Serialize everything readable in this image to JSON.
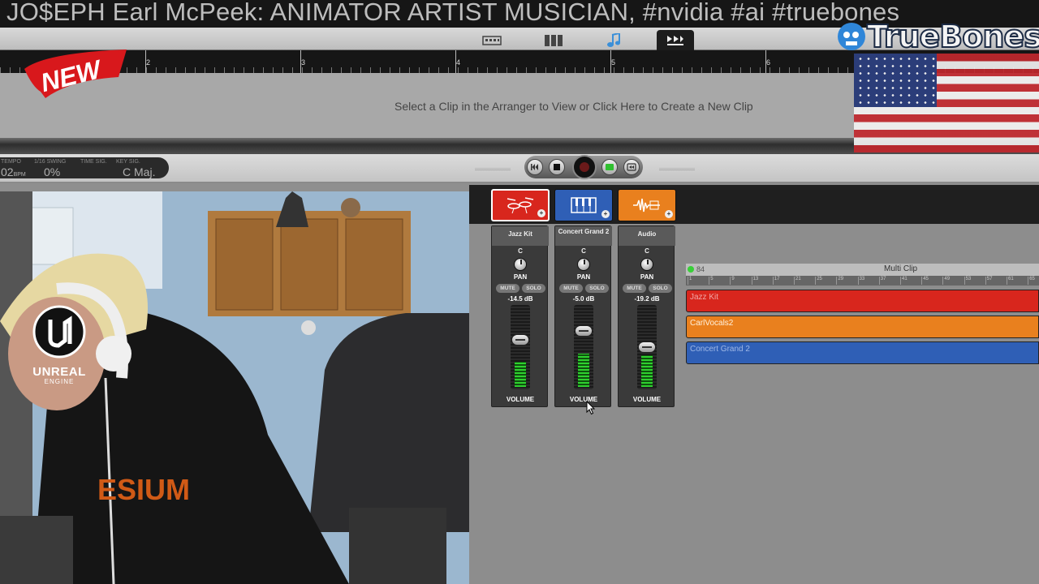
{
  "banner": {
    "title": "JO$EPH Earl McPeek: ANIMATOR ARTIST MUSICIAN, #nvidia #ai #truebones"
  },
  "toolbar": {
    "view_tabs": [
      {
        "icon": "keyboard-view-icon",
        "active": false
      },
      {
        "icon": "mixer-view-icon",
        "active": false
      },
      {
        "icon": "music-note-icon",
        "active": false
      },
      {
        "icon": "arranger-view-icon",
        "active": true
      }
    ]
  },
  "ruler": {
    "bars": [
      "2",
      "3",
      "4",
      "5",
      "6"
    ]
  },
  "clip_editor": {
    "message": "Select a Clip in the Arranger to View or Click Here to Create a New Clip"
  },
  "lcd": {
    "tempo_label": "TEMPO",
    "tempo_value": "02",
    "tempo_unit": "BPM",
    "swing_label": "1/16 SWING",
    "swing_value": "0%",
    "time_sig_label": "TIME SIG.",
    "key_sig_label": "KEY SIG.",
    "key_value": "C",
    "key_mode": "Maj."
  },
  "transport": {
    "buttons": [
      "rewind-icon",
      "stop-icon",
      "record-icon",
      "play-icon",
      "loop-icon"
    ]
  },
  "mixer": {
    "strips": [
      {
        "name": "Jazz Kit",
        "pan": "C",
        "pan_label": "PAN",
        "mute": "MUTE",
        "solo": "SOLO",
        "db": "-14.5 dB",
        "volume_label": "VOLUME",
        "color": "#d8261d",
        "icon": "drum-kit-icon",
        "level": 0.32,
        "fader": 0.6
      },
      {
        "name": "Concert Grand 2",
        "pan": "C",
        "pan_label": "PAN",
        "mute": "MUTE",
        "solo": "SOLO",
        "db": "-5.0 dB",
        "volume_label": "VOLUME",
        "color": "#2f5fb6",
        "icon": "piano-icon",
        "level": 0.42,
        "fader": 0.72
      },
      {
        "name": "Audio",
        "pan": "C",
        "pan_label": "PAN",
        "mute": "MUTE",
        "solo": "SOLO",
        "db": "-19.2 dB",
        "volume_label": "VOLUME",
        "color": "#e9801e",
        "icon": "waveform-icon",
        "level": 0.4,
        "fader": 0.5
      }
    ]
  },
  "multi_clip": {
    "number": "84",
    "title": "Multi Clip",
    "ticks": [
      "1",
      "5",
      "9",
      "13",
      "17",
      "21",
      "25",
      "29",
      "33",
      "37",
      "41",
      "45",
      "49",
      "53",
      "57",
      "61",
      "65"
    ],
    "clips": [
      {
        "name": "Jazz Kit",
        "color": "#d8261d",
        "text_color": "#f0a6a6"
      },
      {
        "name": "CarlVocals2",
        "color": "#e9801e",
        "text_color": "#fff0dc"
      },
      {
        "name": "Concert Grand 2",
        "color": "#2f5fb6",
        "text_color": "#9fb8e6"
      }
    ]
  },
  "overlays": {
    "new_badge": "NEW",
    "brand": "TrueBones",
    "engine_brand": "UNREAL",
    "engine_sub": "ENGINE"
  }
}
